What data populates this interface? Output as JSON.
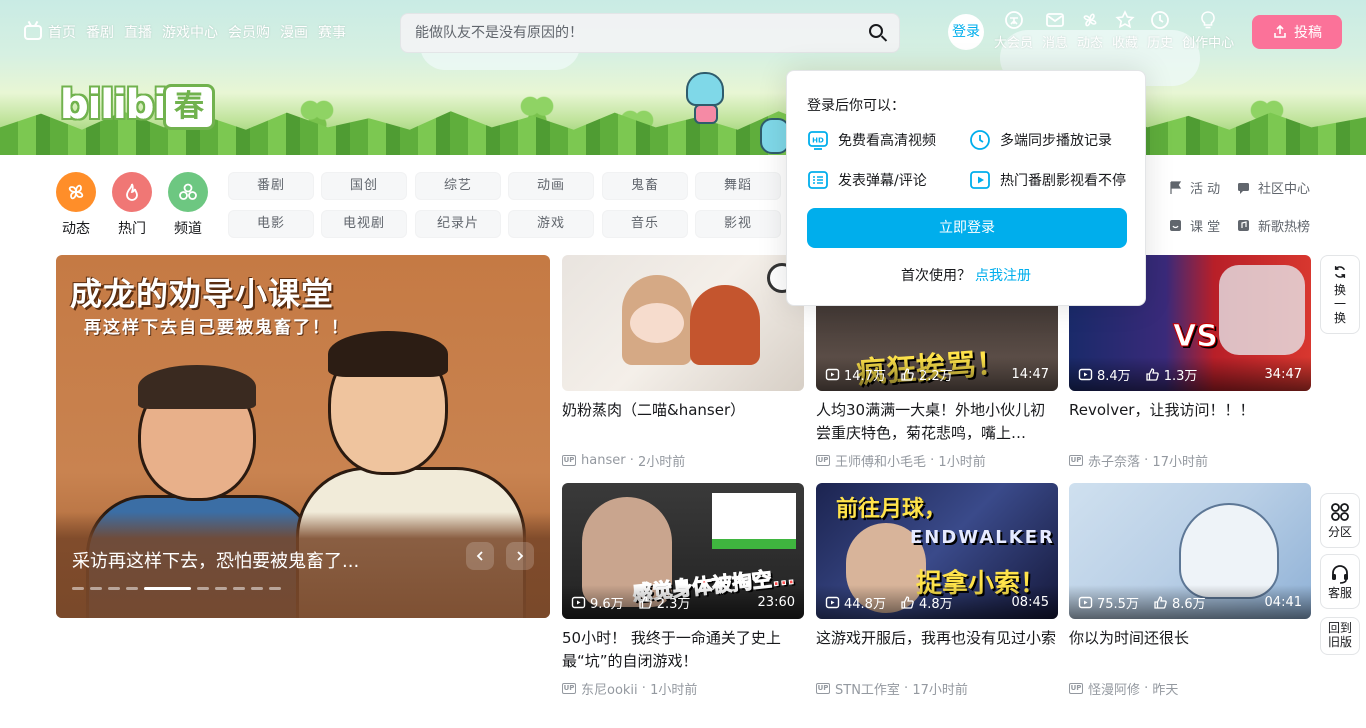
{
  "nav": {
    "items": [
      "首页",
      "番剧",
      "直播",
      "游戏中心",
      "会员购",
      "漫画",
      "赛事"
    ],
    "search_placeholder": "能做队友不是没有原因的！",
    "login": "登录",
    "right_items": [
      "大会员",
      "消息",
      "动态",
      "收藏",
      "历史",
      "创作中心"
    ],
    "upload": "投稿"
  },
  "banner": {
    "logo_text": "bilibili",
    "logo_badge": "春"
  },
  "channels": {
    "circles": [
      {
        "label": "动态",
        "color": "#ff8e29"
      },
      {
        "label": "热门",
        "color": "#f07775"
      },
      {
        "label": "频道",
        "color": "#6dc781"
      }
    ],
    "tags_row1": [
      "番剧",
      "国创",
      "综艺",
      "动画",
      "鬼畜",
      "舞蹈"
    ],
    "tags_row2": [
      "电影",
      "电视剧",
      "纪录片",
      "游戏",
      "音乐",
      "影视"
    ],
    "right_links": [
      "活 动",
      "社区中心",
      "课 堂",
      "新歌热榜"
    ]
  },
  "carousel": {
    "image_title": "成龙的劝导小课堂",
    "image_subtitle": "再这样下去自己要被鬼畜了！！",
    "caption": "采访再这样下去，恐怕要被鬼畜了...",
    "dots_total": 10,
    "active_dot": 4
  },
  "videos": [
    {
      "title": "奶粉蒸肉（二喵&hanser）",
      "author": "hanser",
      "time": "2小时前",
      "plays": "",
      "likes": "",
      "duration": ""
    },
    {
      "title": "人均30满满一大桌！外地小伙儿初尝重庆特色，菊花悲鸣，嘴上…",
      "author": "王师傅和小毛毛",
      "time": "1小时前",
      "plays": "14.7万",
      "likes": "2.2万",
      "duration": "14:47",
      "overlay": "疯狂挨骂！"
    },
    {
      "title": "Revolver，让我访问！！！",
      "author": "赤子奈落",
      "time": "17小时前",
      "plays": "8.4万",
      "likes": "1.3万",
      "duration": "34:47",
      "overlay": "VS"
    },
    {
      "title": "50小时！ 我终于一命通关了史上最“坑”的自闭游戏！",
      "author": "东尼ookii",
      "time": "1小时前",
      "plays": "9.6万",
      "likes": "2.3万",
      "duration": "23:60",
      "overlay": "感觉身体被掏空..."
    },
    {
      "title": "这游戏开服后，我再也没有见过小索",
      "author": "STN工作室",
      "time": "17小时前",
      "plays": "44.8万",
      "likes": "4.8万",
      "duration": "08:45",
      "overlay": "前往月球，",
      "overlay2": "捉拿小索！",
      "overlay3": "ENDWALKER"
    },
    {
      "title": "你以为时间还很长",
      "author": "怪漫阿修",
      "time": "昨天",
      "plays": "75.5万",
      "likes": "8.6万",
      "duration": "04:41"
    }
  ],
  "popup": {
    "header": "登录后你可以：",
    "perks": [
      "免费看高清视频",
      "多端同步播放记录",
      "发表弹幕/评论",
      "热门番剧影视看不停"
    ],
    "button": "立即登录",
    "first_use": "首次使用？",
    "register": "点我注册"
  },
  "side": {
    "refresh": "换一换",
    "zones": "分区",
    "service": "客服",
    "old": "回到旧版"
  },
  "colors": {
    "accent": "#00aeec",
    "pink": "#fb7299"
  }
}
